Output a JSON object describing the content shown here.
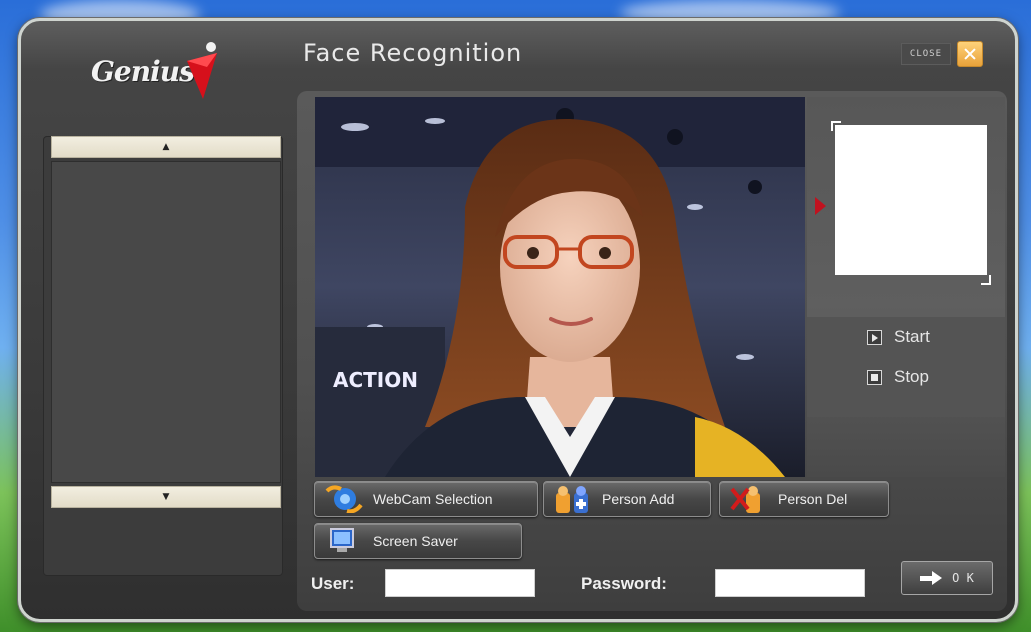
{
  "window": {
    "title": "Face Recognition",
    "close_label": "CLOSE",
    "brand": "Genius"
  },
  "left_list": {
    "scroll_up_glyph": "▲",
    "scroll_down_glyph": "▼"
  },
  "controls": {
    "start_label": "Start",
    "stop_label": "Stop"
  },
  "buttons": {
    "webcam_selection": "WebCam Selection",
    "person_add": "Person Add",
    "person_del": "Person Del",
    "screen_saver": "Screen Saver"
  },
  "login": {
    "user_label": "User:",
    "user_value": "",
    "password_label": "Password:",
    "password_value": "",
    "ok_label": "O K"
  },
  "colors": {
    "accent_red": "#c1121f",
    "close_orange": "#e8a23a",
    "panel_gray": "#3a3a3a"
  },
  "icons": [
    "genius-logo-mark",
    "close-x-icon",
    "play-icon",
    "stop-icon",
    "webcam-icon",
    "person-add-icon",
    "person-del-icon",
    "screen-saver-icon",
    "arrow-right-icon"
  ]
}
